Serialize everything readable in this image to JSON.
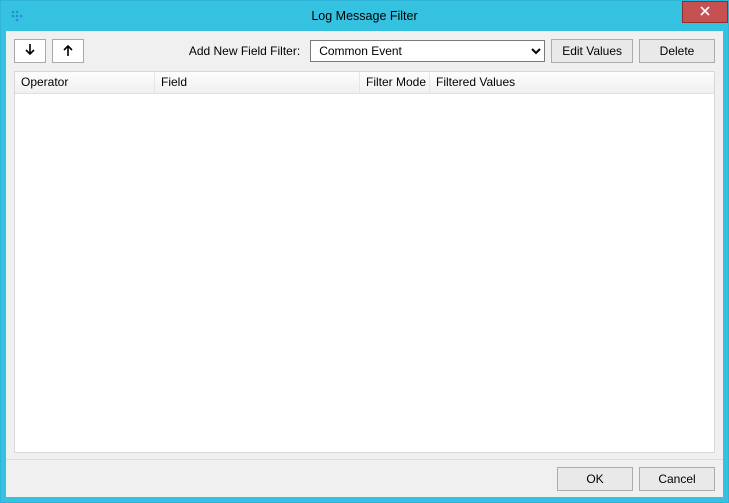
{
  "window": {
    "title": "Log Message Filter"
  },
  "toolbar": {
    "add_label": "Add New Field Filter:",
    "filter_select_value": "Common Event",
    "edit_values_label": "Edit Values",
    "delete_label": "Delete"
  },
  "grid": {
    "columns": {
      "operator": "Operator",
      "field": "Field",
      "filter_mode": "Filter Mode",
      "filtered_values": "Filtered Values"
    },
    "rows": []
  },
  "footer": {
    "ok_label": "OK",
    "cancel_label": "Cancel"
  }
}
